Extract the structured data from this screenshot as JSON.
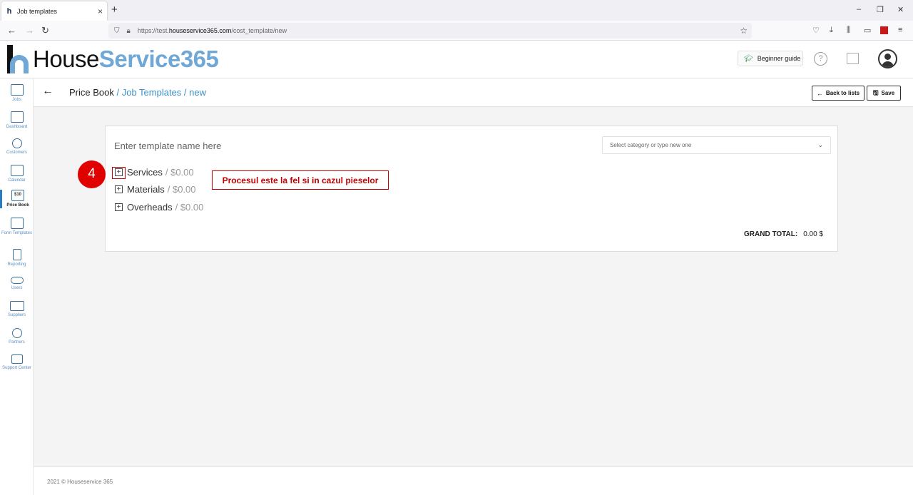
{
  "browser": {
    "tab_title": "Job templates",
    "tab_favicon": "h",
    "tab_close": "×",
    "new_tab": "+",
    "url_prefix": "https://test.",
    "url_domain": "houseservice365.com",
    "url_path": "/cost_template/new",
    "window_controls": [
      "–",
      "❐",
      "✕"
    ],
    "nav": {
      "back": "←",
      "forward": "→",
      "reload": "↻"
    },
    "toolbar_icons": [
      "pocket-icon",
      "download-icon",
      "library-icon",
      "sidebar-icon",
      "extension-icon",
      "menu-icon"
    ]
  },
  "header": {
    "logo_part1": "House",
    "logo_part2": "Service365",
    "beginner_guide": "Beginner guide",
    "help": "?"
  },
  "sidebar": {
    "items": [
      {
        "label": "Jobs",
        "icon": "tools-icon"
      },
      {
        "label": "Dashboard",
        "icon": "chart-icon"
      },
      {
        "label": "Customers",
        "icon": "customers-icon"
      },
      {
        "label": "Calendar",
        "icon": "calendar-icon"
      },
      {
        "label": "Price Book",
        "icon": "price-tag-icon"
      },
      {
        "label": "Form Templates",
        "icon": "form-icon"
      },
      {
        "label": "Reporting",
        "icon": "report-icon"
      },
      {
        "label": "Users",
        "icon": "users-icon"
      },
      {
        "label": "Suppliers",
        "icon": "truck-icon"
      },
      {
        "label": "Partners",
        "icon": "partners-icon"
      },
      {
        "label": "Support Center",
        "icon": "support-icon"
      }
    ],
    "active_index": 4,
    "price_icon_text": "$10"
  },
  "breadcrumb": {
    "root": "Price Book",
    "sep": " / ",
    "section": "Job Templates",
    "current": "new"
  },
  "actions": {
    "back_to_lists": "Back to lists",
    "save": "Save"
  },
  "form": {
    "template_name_placeholder": "Enter template name here",
    "category_placeholder": "Select category or type new one",
    "sections": [
      {
        "name": "Services",
        "amount": "/ $0.00"
      },
      {
        "name": "Materials",
        "amount": "/ $0.00"
      },
      {
        "name": "Overheads",
        "amount": "/ $0.00"
      }
    ],
    "grand_total_label": "GRAND TOTAL:",
    "grand_total_value": "0.00 $"
  },
  "annotation": {
    "step_number": "4",
    "callout_text": "Procesul este la fel si in cazul pieselor",
    "color": "#c00000"
  },
  "footer": {
    "copyright": "2021 © Houseservice 365"
  },
  "colors": {
    "brand_blue": "#6fa8d6",
    "link_blue": "#3a8fc7",
    "annotation_red": "#e00000"
  }
}
